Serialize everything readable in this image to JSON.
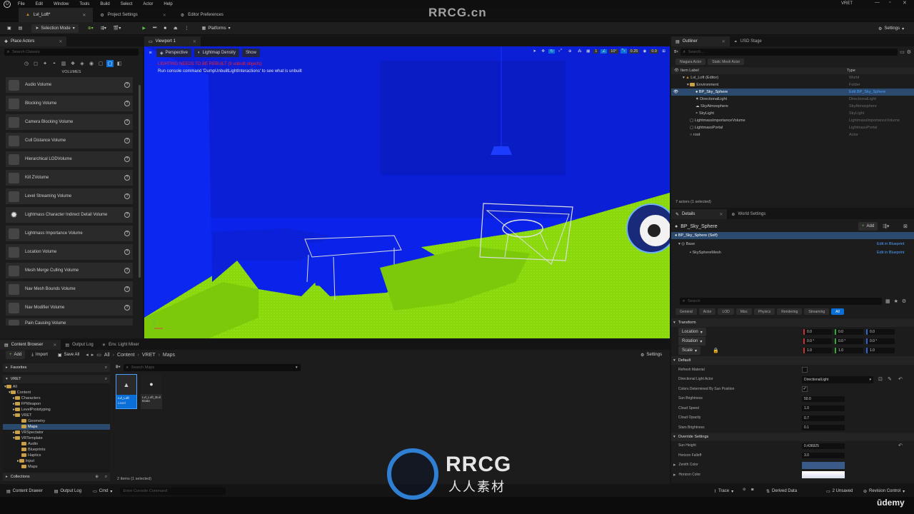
{
  "menu": {
    "items": [
      "File",
      "Edit",
      "Window",
      "Tools",
      "Build",
      "Select",
      "Actor",
      "Help"
    ],
    "project": "VRET"
  },
  "tabs": {
    "level": "Lvl_Loft*",
    "project_settings": "Project Settings",
    "editor_prefs": "Editor Preferences"
  },
  "toolbar": {
    "mode": "Selection Mode",
    "platforms": "Platforms",
    "settings": "Settings"
  },
  "place_actors": {
    "title": "Place Actors",
    "search_placeholder": "Search Classes",
    "section": "VOLUMES",
    "items": [
      "Audio Volume",
      "Blocking Volume",
      "Camera Blocking Volume",
      "Cull Distance Volume",
      "Hierarchical LODVolume",
      "Kill ZVolume",
      "Level Streaming Volume",
      "Lightmass Character Indirect Detail Volume",
      "Lightmass Importance Volume",
      "Location Volume",
      "Mesh Merge Culling Volume",
      "Nav Mesh Bounds Volume",
      "Nav Modifier Volume",
      "Pain Causing Volume"
    ]
  },
  "viewport": {
    "tab": "Viewport 1",
    "perspective": "Perspective",
    "view_mode": "Lightmap Density",
    "show": "Show",
    "warning": "LIGHTING NEEDS TO BE REBUILT (9 unbuilt objects)",
    "hint": "Run console command 'DumpUnbuiltLightInteractions' to see what is unbuilt",
    "grid": "10",
    "angle": "10°",
    "scale": "0.25",
    "camspeed": "0.9",
    "count": "1"
  },
  "outliner": {
    "tab": "Outliner",
    "usd": "USD Stage",
    "search_placeholder": "Search...",
    "filter1": "Niagara Actor",
    "filter2": "Static Mesh Actor",
    "col_label": "Item Label",
    "col_type": "Type",
    "rows": [
      {
        "label": "Lvl_Loft (Editor)",
        "type": "World"
      },
      {
        "label": "Environment",
        "type": "Folder"
      },
      {
        "label": "BP_Sky_Sphere",
        "type": "Edit BP_Sky_Sphere"
      },
      {
        "label": "DirectionalLight",
        "type": "DirectionalLight"
      },
      {
        "label": "SkyAtmosphere",
        "type": "SkyAtmosphere"
      },
      {
        "label": "SkyLight",
        "type": "SkyLight"
      },
      {
        "label": "LightmassImportanceVolume",
        "type": "LightmassImportanceVolume"
      },
      {
        "label": "LightmassPortal",
        "type": "LightmassPortal"
      },
      {
        "label": "root",
        "type": "Actor"
      }
    ],
    "status": "7 actors (1 selected)"
  },
  "details": {
    "tab": "Details",
    "world": "World Settings",
    "name": "BP_Sky_Sphere",
    "add": "Add",
    "self": "BP_Sky_Sphere (Self)",
    "base": "Base",
    "mesh": "SkySphereMesh",
    "edit_bp": "Edit in Blueprint",
    "search_placeholder": "Search",
    "filters": [
      "General",
      "Actor",
      "LOD",
      "Misc",
      "Physics",
      "Rendering",
      "Streaming",
      "All"
    ],
    "transform": "Transform",
    "location": "Location",
    "rotation": "Rotation",
    "scale": "Scale",
    "loc": [
      "0.0",
      "0.0",
      "0.0"
    ],
    "rot": [
      "0.0 °",
      "0.0 °",
      "0.0 °"
    ],
    "scl": [
      "1.0",
      "1.0",
      "1.0"
    ],
    "default": "Default",
    "refresh": "Refresh Material",
    "dir_light_actor": "Directional Light Actor",
    "dir_light_val": "DirectionalLight",
    "colors_sun": "Colors Determined By Sun Position",
    "sun_brightness": "Sun Brightness",
    "sun_brightness_val": "50.0",
    "cloud_speed": "Cloud Speed",
    "cloud_speed_val": "1.0",
    "cloud_opacity": "Cloud Opacity",
    "cloud_opacity_val": "0.7",
    "stars": "Stars Brightness",
    "stars_val": "0.1",
    "override": "Override Settings",
    "sun_height": "Sun Height",
    "sun_height_val": "0.436925",
    "horizon_falloff": "Horizon Falloff",
    "horizon_falloff_val": "3.0",
    "zenith": "Zenith Color",
    "horizon": "Horizon Color"
  },
  "content": {
    "tab": "Content Browser",
    "output": "Output Log",
    "env": "Env. Light Mixer",
    "add": "Add",
    "import": "Import",
    "save_all": "Save All",
    "crumbs": [
      "All",
      "Content",
      "VRET",
      "Maps"
    ],
    "settings": "Settings",
    "favorites": "Favorites",
    "project": "VRET",
    "search_placeholder": "Search Maps",
    "tree": [
      "All",
      "Content",
      "Characters",
      "FPWeapon",
      "LevelPrototyping",
      "VRET",
      "Geometry",
      "Maps",
      "VRSpectator",
      "VRTemplate",
      "Audio",
      "Blueprints",
      "Haptics",
      "Input",
      "Maps"
    ],
    "asset1": "Lvl_Loft",
    "asset1_type": "Level",
    "asset2": "Lvl_Loft_BuiltData",
    "collections": "Collections",
    "status": "2 items (1 selected)"
  },
  "statusbar": {
    "drawer": "Content Drawer",
    "output": "Output Log",
    "cmd": "Cmd",
    "console_placeholder": "Enter Console Command",
    "trace": "Trace",
    "derived": "Derived Data",
    "unsaved": "2 Unsaved",
    "revision": "Revision Control"
  },
  "watermark": {
    "brand": "RRCG.cn",
    "logo_top": "RRCG",
    "logo_bottom": "人人素材",
    "udemy": "ūdemy"
  },
  "colors": {
    "accent": "#0a70d8",
    "viewport_blue": "#0a22ea",
    "viewport_green": "#8ad80a",
    "selection": "#2c4a6e"
  }
}
